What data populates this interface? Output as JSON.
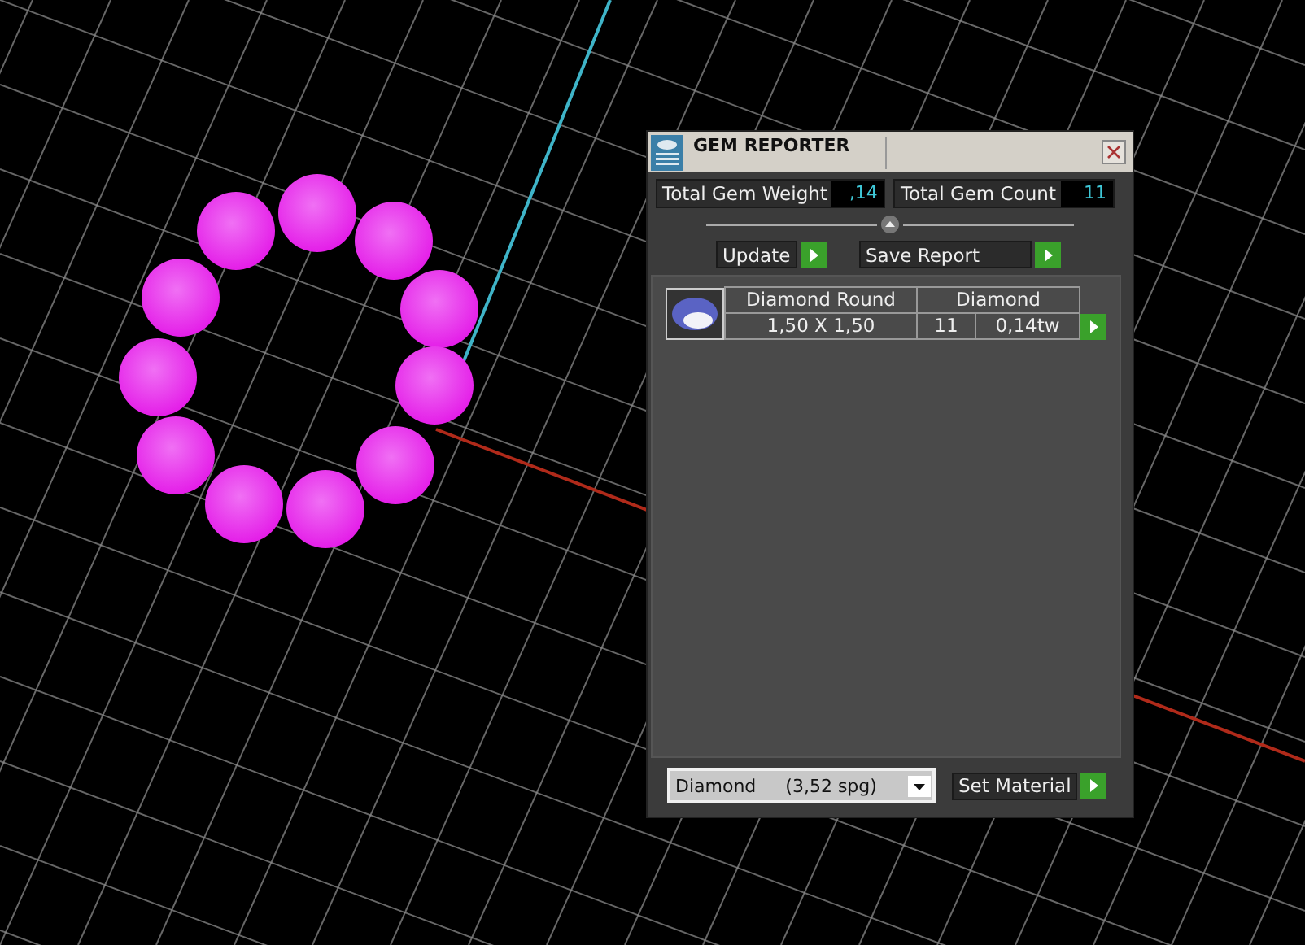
{
  "window": {
    "title": "GEM REPORTER"
  },
  "totals": [
    {
      "label": "Total Gem Weight",
      "value": ",14"
    },
    {
      "label": "Total Gem Count",
      "value": "11"
    }
  ],
  "buttons": [
    "Update",
    "Save Report"
  ],
  "gems": [
    {
      "name": "Diamond Round",
      "material": "Diamond",
      "size": "1,50 X 1,50",
      "count": "11",
      "weight": "0,14tw"
    }
  ],
  "material_select": {
    "material": "Diamond",
    "density": "(3,52 spg)"
  },
  "set_button": "Set Material"
}
